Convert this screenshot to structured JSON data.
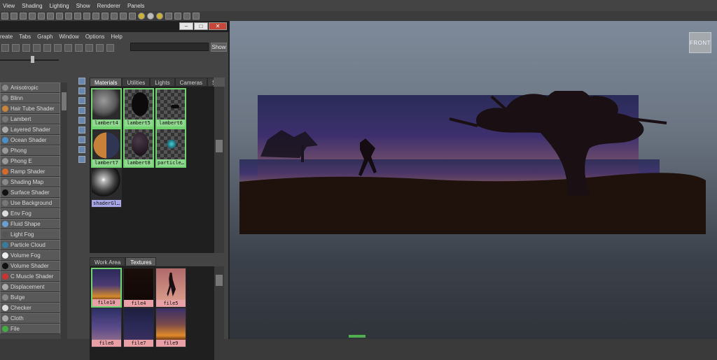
{
  "viewport": {
    "menu": [
      "View",
      "Shading",
      "Lighting",
      "Show",
      "Renderer",
      "Panels"
    ],
    "cube_label": "FRONT"
  },
  "hypershade": {
    "menu": [
      "reate",
      "Tabs",
      "Graph",
      "Window",
      "Options",
      "Help"
    ],
    "show_label": "Show",
    "window_controls": [
      "minimize",
      "maximize",
      "close"
    ],
    "nodes": [
      {
        "label": "Anisotropic",
        "icon": "#888"
      },
      {
        "label": "Blinn",
        "icon": "#888"
      },
      {
        "label": "Hair Tube Shader",
        "icon": "#c8843a"
      },
      {
        "label": "Lambert",
        "icon": "#777"
      },
      {
        "label": "Layered Shader",
        "icon": "#aaa"
      },
      {
        "label": "Ocean Shader",
        "icon": "#4a8fc7"
      },
      {
        "label": "Phong",
        "icon": "#999"
      },
      {
        "label": "Phong E",
        "icon": "#999"
      },
      {
        "label": "Ramp Shader",
        "icon": "#d66a2a"
      },
      {
        "label": "Shading Map",
        "icon": "#888"
      },
      {
        "label": "Surface Shader",
        "icon": "#111"
      },
      {
        "label": "Use Background",
        "icon": "#777"
      },
      {
        "label": "Env Fog",
        "icon": "#ddd"
      },
      {
        "label": "Fluid Shape",
        "icon": "#6aa0d0"
      },
      {
        "label": "Light Fog",
        "icon": "#555"
      },
      {
        "label": "Particle Cloud",
        "icon": "#3a7a9a"
      },
      {
        "label": "Volume Fog",
        "icon": "#eee"
      },
      {
        "label": "Volume Shader",
        "icon": "#111"
      },
      {
        "label": "C Muscle Shader",
        "icon": "#c33"
      },
      {
        "label": "Displacement",
        "icon": "#aaa"
      },
      {
        "label": "Bulge",
        "icon": "#888"
      },
      {
        "label": "Checker",
        "icon": "#ddd"
      },
      {
        "label": "Cloth",
        "icon": "#aaa"
      },
      {
        "label": "File",
        "icon": "#4a4"
      }
    ],
    "material_tabs": [
      "Materials",
      "Utilities",
      "Lights",
      "Cameras",
      "Sh"
    ],
    "materials": [
      {
        "label": "lambert4",
        "style": "sphere-grey"
      },
      {
        "label": "lambert5",
        "style": "checker-dark"
      },
      {
        "label": "lambert6",
        "style": "checker-small"
      },
      {
        "label": "lambert7",
        "style": "sphere-half"
      },
      {
        "label": "lambert8",
        "style": "sphere-dark"
      },
      {
        "label": "particle…",
        "style": "checker-cyan"
      },
      {
        "label": "shaderGl…",
        "style": "sphere-glossy"
      }
    ],
    "work_tabs": [
      "Work Area",
      "Textures"
    ],
    "textures": [
      {
        "label": "file10",
        "style": "tex-sky-glow"
      },
      {
        "label": "file4",
        "style": "tex-black"
      },
      {
        "label": "file5",
        "style": "tex-figure"
      },
      {
        "label": "file6",
        "style": "tex-purple"
      },
      {
        "label": "file7",
        "style": "tex-dark-purple"
      },
      {
        "label": "file9",
        "style": "tex-orange-glow"
      }
    ]
  }
}
